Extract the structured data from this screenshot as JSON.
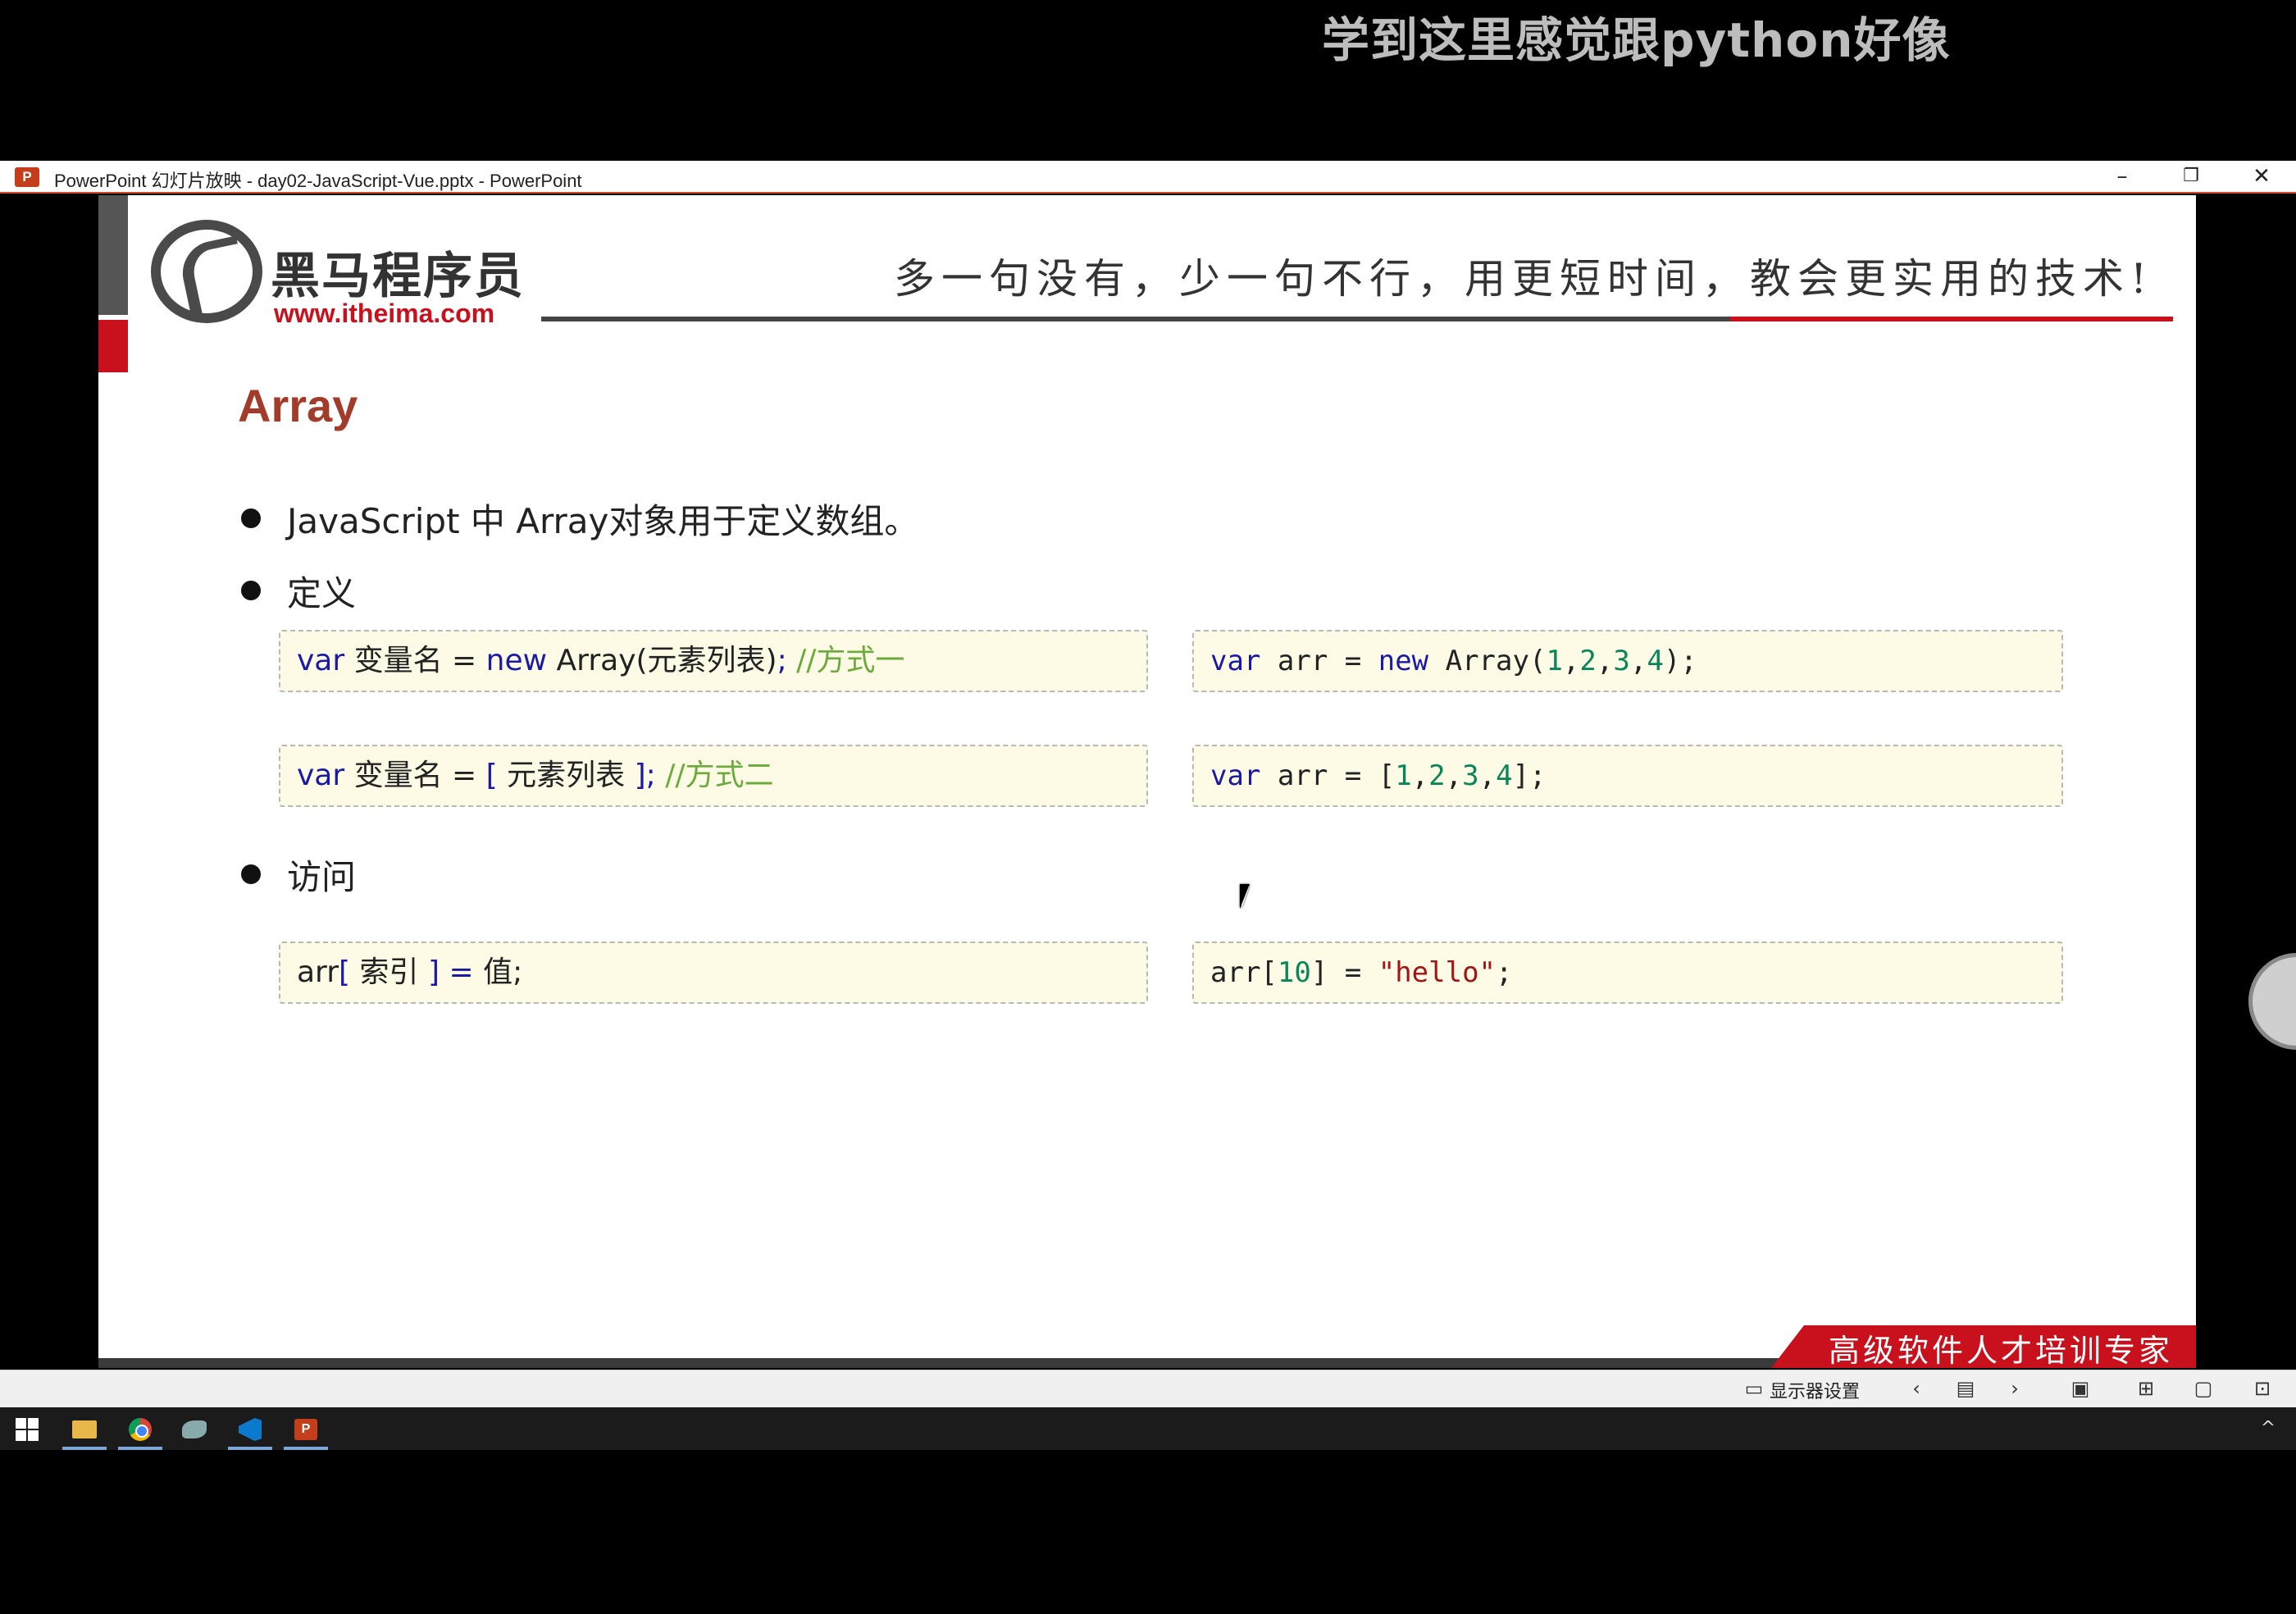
{
  "overlay": {
    "danmaku": "学到这里感觉跟python好像"
  },
  "window": {
    "app_icon_letter": "P",
    "title": "PowerPoint 幻灯片放映  -  day02-JavaScript-Vue.pptx - PowerPoint",
    "controls": {
      "minimize": "–",
      "restore": "❐",
      "close": "✕"
    }
  },
  "slide": {
    "logo": {
      "name_cn": "黑马程序员",
      "url": "www.itheima.com"
    },
    "slogan": "多一句没有，少一句不行，用更短时间，教会更实用的技术!",
    "title": "Array",
    "bullets": [
      "JavaScript 中 Array对象用于定义数组。",
      "定义",
      "访问"
    ],
    "definition_way1": {
      "kw_var": "var",
      "name": " 变量名 = ",
      "kw_new": "new",
      "ctor": " Array(元素列表)",
      "semi": ";",
      "comment": " //方式一"
    },
    "definition_way1_example": {
      "kw_var": "var",
      "pre": " arr = ",
      "kw_new": "new",
      "ctor": " Array(",
      "n1": "1",
      "n2": "2",
      "n3": "3",
      "n4": "4",
      "comma": ",",
      "close": ");"
    },
    "definition_way2": {
      "kw_var": "var",
      "name": " 变量名 = ",
      "lb": "[",
      "items": " 元素列表 ",
      "rb": "]",
      "semi": ";",
      "comment": " //方式二"
    },
    "definition_way2_example": {
      "kw_var": "var",
      "pre": " arr = [",
      "n1": "1",
      "n2": "2",
      "n3": "3",
      "n4": "4",
      "comma": ",",
      "close": "];"
    },
    "access_syntax": {
      "arr": "arr",
      "lb": "[",
      "index": " 索引 ",
      "rb": "]",
      "eq": " = ",
      "value": "值;"
    },
    "access_example": {
      "pre": "arr[",
      "index": "10",
      "mid": "] = ",
      "str": "\"hello\"",
      "semi": ";"
    },
    "footer_banner": "高级软件人才培训专家"
  },
  "statusbar": {
    "display_settings": "显示器设置",
    "icons": [
      "monitor-icon",
      "prev-icon",
      "slide-sorter-icon",
      "next-icon",
      "normal-view-icon",
      "grid-view-icon",
      "reading-view-icon",
      "slideshow-icon"
    ]
  },
  "taskbar": {
    "items": [
      "start-icon",
      "file-explorer-icon",
      "chrome-icon",
      "fish-app-icon",
      "vscode-icon",
      "powerpoint-icon"
    ],
    "ppt_letter": "P",
    "tray_up": "^"
  }
}
